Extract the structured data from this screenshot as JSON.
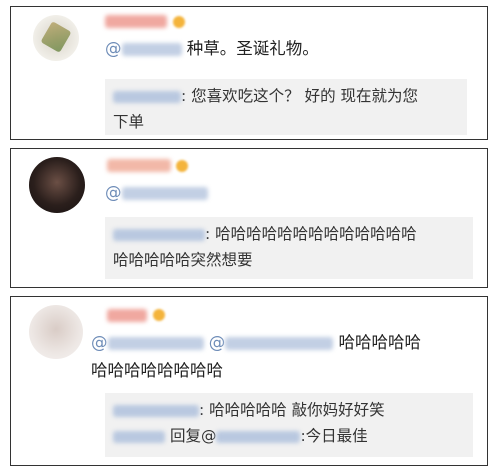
{
  "comments": [
    {
      "main_text": "种草。圣诞礼物。",
      "reply_text_1": ": 您喜欢吃这个？ 好的 现在就为您",
      "reply_text_2": "下单"
    },
    {
      "reply_text_1": ": 哈哈哈哈哈哈哈哈哈哈哈哈哈",
      "reply_text_2": "哈哈哈哈哈突然想要"
    },
    {
      "main_text_1": "哈哈哈哈哈",
      "main_text_2": "哈哈哈哈哈哈哈哈",
      "reply_a": ": 哈哈哈哈哈 敲你妈好好笑",
      "reply_b_prefix": "回复@",
      "reply_b_suffix": ":今日最佳"
    }
  ],
  "mention_symbol": "@",
  "colors": {
    "mention": "#6f8db8",
    "name_blur": "#f0a8a0",
    "quote_bg": "#f1f1f1"
  }
}
